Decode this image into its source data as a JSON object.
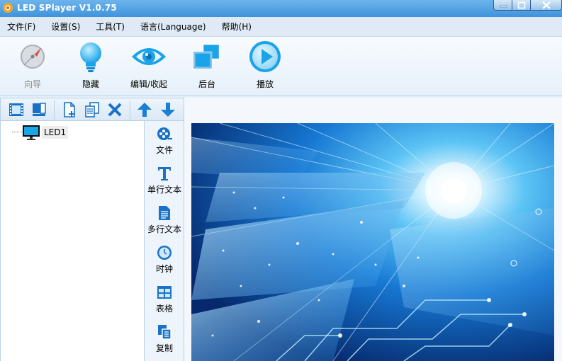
{
  "window": {
    "title": "LED SPlayer V1.0.75",
    "icon": "app-logo-icon"
  },
  "menu": [
    {
      "label": "文件(F)"
    },
    {
      "label": "设置(S)"
    },
    {
      "label": "工具(T)"
    },
    {
      "label": "语言(Language)"
    },
    {
      "label": "帮助(H)"
    }
  ],
  "toolbar": [
    {
      "label": "向导",
      "icon": "wizard-icon",
      "enabled": false
    },
    {
      "label": "隐藏",
      "icon": "bulb-icon",
      "enabled": true
    },
    {
      "label": "编辑/收起",
      "icon": "eye-icon",
      "enabled": true
    },
    {
      "label": "后台",
      "icon": "windows-icon",
      "enabled": true
    },
    {
      "label": "播放",
      "icon": "play-icon",
      "enabled": true
    }
  ],
  "left_toolbar": [
    {
      "icon": "film-icon"
    },
    {
      "icon": "screen-icon"
    },
    {
      "icon": "new-page-icon"
    },
    {
      "icon": "copy-pages-icon"
    },
    {
      "icon": "delete-icon"
    },
    {
      "icon": "arrow-up-icon"
    },
    {
      "icon": "arrow-down-icon"
    }
  ],
  "tree": {
    "items": [
      {
        "label": "LED1",
        "icon": "monitor-icon"
      }
    ]
  },
  "side_tools": [
    {
      "label": "文件",
      "icon": "film-reel-icon"
    },
    {
      "label": "单行文本",
      "icon": "text-t-icon"
    },
    {
      "label": "多行文本",
      "icon": "document-icon"
    },
    {
      "label": "时钟",
      "icon": "clock-icon"
    },
    {
      "label": "表格",
      "icon": "table-icon"
    },
    {
      "label": "复制",
      "icon": "copy-icon"
    }
  ],
  "colors": {
    "titlebar": "#3f93db",
    "accent_blue": "#1e90e6",
    "panel": "#eef4fb"
  }
}
